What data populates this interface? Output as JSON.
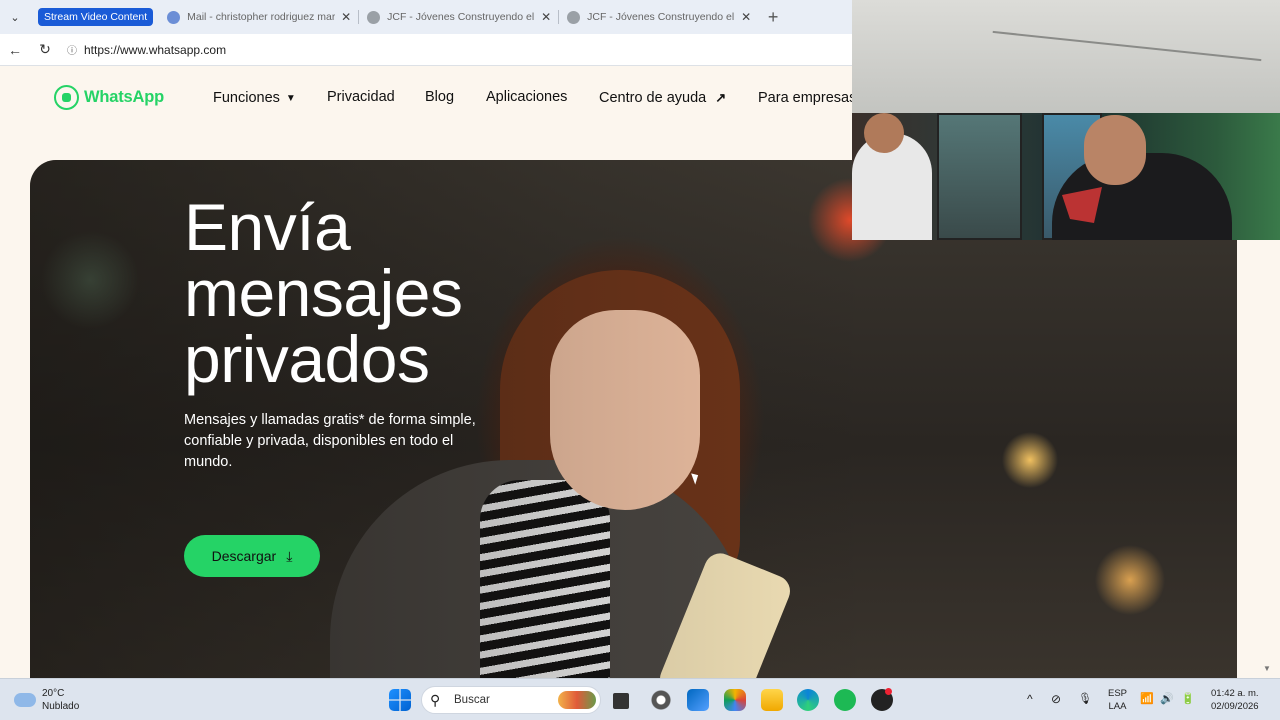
{
  "browser": {
    "tab_group_label": "Stream Video Content",
    "tabs": [
      {
        "title": "Mail - christopher rodriguez martinez",
        "favicon_color": "#6b8ed6"
      },
      {
        "title": "JCF - Jóvenes Construyendo el Futuro",
        "favicon_color": "#9aa0a6"
      },
      {
        "title": "JCF - Jóvenes Construyendo el Futuro",
        "favicon_color": "#9aa0a6"
      }
    ],
    "url": "https://www.whatsapp.com",
    "icons": {
      "back": "←",
      "reload": "↻",
      "new_tab": "+",
      "close": "✕",
      "tab_list": "⌄",
      "site_info": "ⓘ"
    }
  },
  "whatsapp": {
    "brand": "WhatsApp",
    "brand_color": "#25d366",
    "nav": {
      "funciones": "Funciones",
      "privacidad": "Privacidad",
      "blog": "Blog",
      "aplicaciones": "Aplicaciones",
      "centro": "Centro de ayuda",
      "empresas": "Para empresas"
    },
    "hero": {
      "title_line1": "Envía",
      "title_line2": "mensajes",
      "title_line3": "privados",
      "subtitle": "Mensajes y llamadas gratis* de forma simple, confiable y privada, disponibles en todo el mundo.",
      "download_label": "Descargar"
    }
  },
  "taskbar": {
    "weather_temp": "20°C",
    "weather_desc": "Nublado",
    "search_label": "Buscar",
    "lang_top": "ESP",
    "lang_bottom": "LAA",
    "time": "01:42 a. m.",
    "date": "02/09/2026",
    "icons": {
      "chevron": "^",
      "mic": "🎙",
      "volume": "🔊",
      "wifi": "📶",
      "battery": "🔋",
      "network_off": "⊘"
    }
  }
}
